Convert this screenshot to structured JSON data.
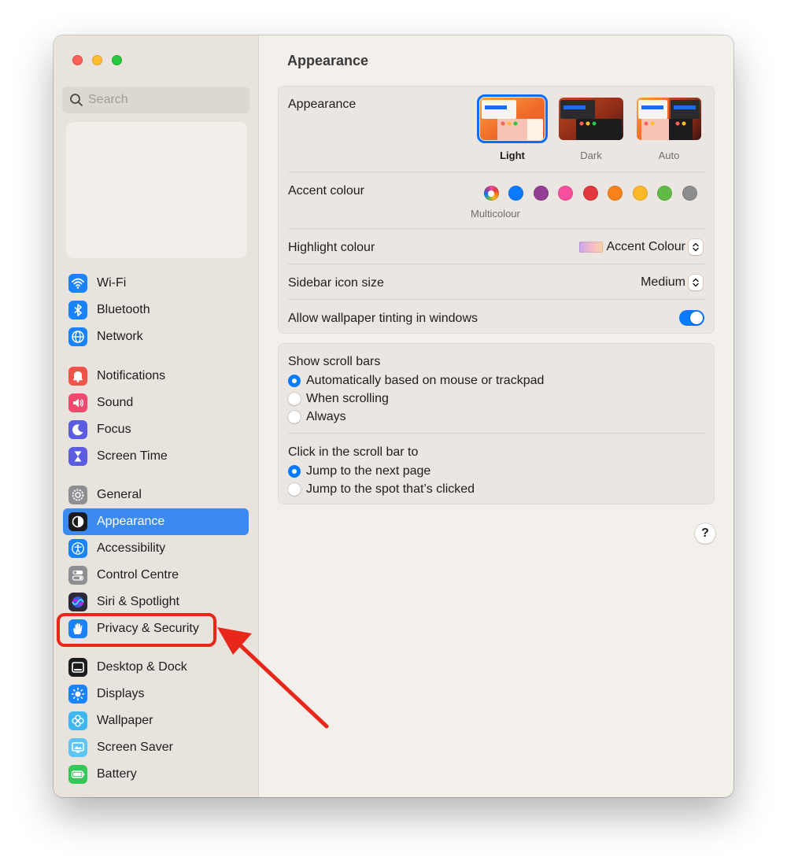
{
  "sidebar": {
    "search_placeholder": "Search",
    "groups": [
      [
        {
          "label": "Wi-Fi",
          "icon": "wifi-icon",
          "color": "#1a82fb"
        },
        {
          "label": "Bluetooth",
          "icon": "bluetooth-icon",
          "color": "#1a82fb"
        },
        {
          "label": "Network",
          "icon": "globe-icon",
          "color": "#1a82fb"
        }
      ],
      [
        {
          "label": "Notifications",
          "icon": "bell-icon",
          "color": "#f05449"
        },
        {
          "label": "Sound",
          "icon": "speaker-icon",
          "color": "#f0486e"
        },
        {
          "label": "Focus",
          "icon": "moon-icon",
          "color": "#5c5ce0"
        },
        {
          "label": "Screen Time",
          "icon": "hourglass-icon",
          "color": "#5c5ce0"
        }
      ],
      [
        {
          "label": "General",
          "icon": "gear-icon",
          "color": "#8e8e93"
        },
        {
          "label": "Appearance",
          "icon": "appearance-icon",
          "color": "#1c1c1e",
          "selected": true
        },
        {
          "label": "Accessibility",
          "icon": "accessibility-icon",
          "color": "#1a82fb"
        },
        {
          "label": "Control Centre",
          "icon": "toggles-icon",
          "color": "#8e8e93"
        },
        {
          "label": "Siri & Spotlight",
          "icon": "siri-icon",
          "color": "#2a2a3a"
        },
        {
          "label": "Privacy & Security",
          "icon": "hand-icon",
          "color": "#1a82fb"
        }
      ],
      [
        {
          "label": "Desktop & Dock",
          "icon": "dock-icon",
          "color": "#1c1c1e"
        },
        {
          "label": "Displays",
          "icon": "sun-icon",
          "color": "#1a82fb"
        },
        {
          "label": "Wallpaper",
          "icon": "flower-icon",
          "color": "#3fb6f0"
        },
        {
          "label": "Screen Saver",
          "icon": "screensaver-icon",
          "color": "#5ec5f2"
        },
        {
          "label": "Battery",
          "icon": "battery-icon",
          "color": "#34c759"
        }
      ]
    ]
  },
  "main": {
    "title": "Appearance",
    "appearance": {
      "label": "Appearance",
      "options": [
        {
          "label": "Light",
          "selected": true
        },
        {
          "label": "Dark",
          "selected": false
        },
        {
          "label": "Auto",
          "selected": false
        }
      ]
    },
    "accent": {
      "label": "Accent colour",
      "selected_caption": "Multicolour",
      "colors": [
        {
          "name": "multicolour",
          "hex": "multicolour",
          "selected": true
        },
        {
          "name": "blue",
          "hex": "#0a7aff"
        },
        {
          "name": "purple",
          "hex": "#953d96"
        },
        {
          "name": "pink",
          "hex": "#f74f9e"
        },
        {
          "name": "red",
          "hex": "#e0383e"
        },
        {
          "name": "orange",
          "hex": "#f7821b"
        },
        {
          "name": "yellow",
          "hex": "#fcb827"
        },
        {
          "name": "green",
          "hex": "#62ba46"
        },
        {
          "name": "graphite",
          "hex": "#8c8c8c"
        }
      ]
    },
    "highlight": {
      "label": "Highlight colour",
      "value": "Accent Colour"
    },
    "sidebar_icon_size": {
      "label": "Sidebar icon size",
      "value": "Medium"
    },
    "wallpaper_tinting": {
      "label": "Allow wallpaper tinting in windows",
      "enabled": true
    },
    "scroll_bars": {
      "label": "Show scroll bars",
      "options": [
        {
          "label": "Automatically based on mouse or trackpad",
          "checked": true
        },
        {
          "label": "When scrolling",
          "checked": false
        },
        {
          "label": "Always",
          "checked": false
        }
      ]
    },
    "click_scroll": {
      "label": "Click in the scroll bar to",
      "options": [
        {
          "label": "Jump to the next page",
          "checked": true
        },
        {
          "label": "Jump to the spot that’s clicked",
          "checked": false
        }
      ]
    },
    "help_label": "?"
  },
  "annotation": {
    "highlight_target": "Privacy & Security",
    "color": "#e8271a"
  }
}
